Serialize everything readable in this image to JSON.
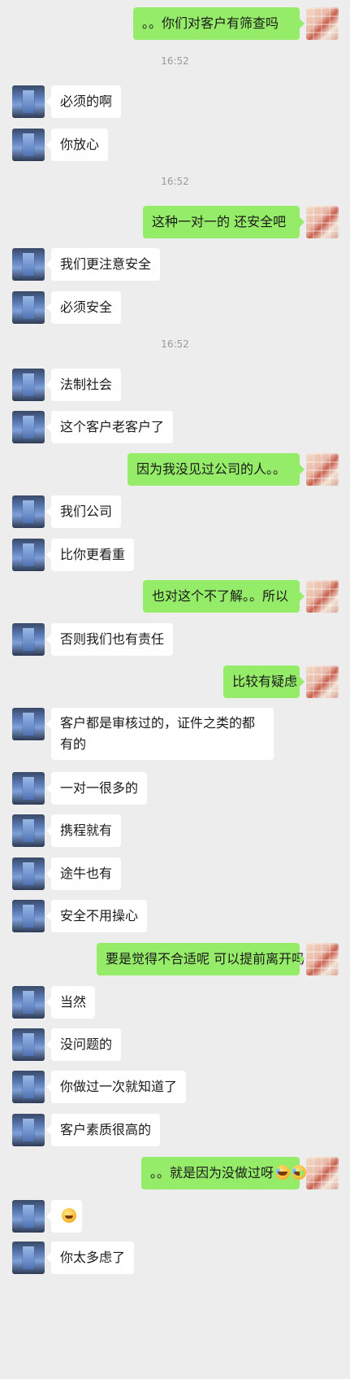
{
  "messages": [
    {
      "side": "sent",
      "text": "。。你们对客户有筛查吗"
    },
    {
      "time": "16:52"
    },
    {
      "side": "recv",
      "text": "必须的啊"
    },
    {
      "side": "recv",
      "text": "你放心"
    },
    {
      "time": "16:52"
    },
    {
      "side": "sent",
      "text": "这种一对一的 还安全吧"
    },
    {
      "side": "recv",
      "text": "我们更注意安全"
    },
    {
      "side": "recv",
      "text": "必须安全"
    },
    {
      "time": "16:52"
    },
    {
      "side": "recv",
      "text": "法制社会"
    },
    {
      "side": "recv",
      "text": "这个客户老客户了"
    },
    {
      "side": "sent",
      "text": "因为我没见过公司的人。。"
    },
    {
      "side": "recv",
      "text": "我们公司"
    },
    {
      "side": "recv",
      "text": "比你更看重"
    },
    {
      "side": "sent",
      "text": "也对这个不了解。。所以"
    },
    {
      "side": "recv",
      "text": "否则我们也有责任"
    },
    {
      "side": "sent",
      "text": "比较有疑虑"
    },
    {
      "side": "recv",
      "text": "客户都是审核过的，证件之类的都有的",
      "tall": true
    },
    {
      "side": "recv",
      "text": "一对一很多的"
    },
    {
      "side": "recv",
      "text": "携程就有"
    },
    {
      "side": "recv",
      "text": "途牛也有"
    },
    {
      "side": "recv",
      "text": "安全不用操心"
    },
    {
      "side": "sent",
      "text": "要是觉得不合适呢 可以提前离开吗"
    },
    {
      "side": "recv",
      "text": "当然"
    },
    {
      "side": "recv",
      "text": "没问题的"
    },
    {
      "side": "recv",
      "text": "你做过一次就知道了"
    },
    {
      "side": "recv",
      "text": "客户素质很高的"
    },
    {
      "side": "sent",
      "text": "。。就是因为没做过呀",
      "emoji": [
        "cry-laugh-icon",
        "cry-laugh-icon"
      ]
    },
    {
      "side": "recv",
      "text": "",
      "emoji": [
        "grin-icon"
      ]
    },
    {
      "side": "recv",
      "text": "你太多虑了"
    }
  ]
}
